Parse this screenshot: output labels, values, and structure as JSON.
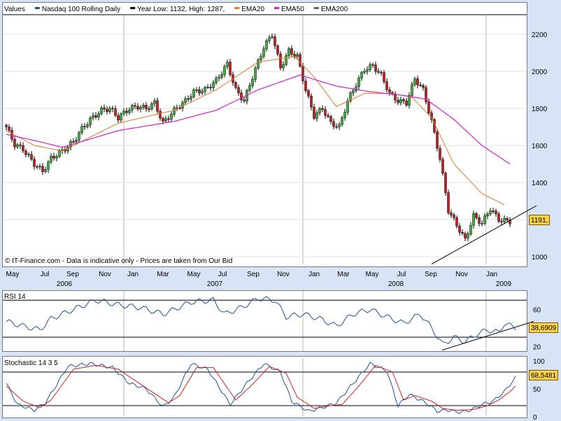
{
  "chart_data": [
    {
      "type": "candlestick",
      "title": "Nasdaq 100 Rolling Daily",
      "legend": [
        {
          "label": "Values",
          "color": "#000000"
        },
        {
          "label": "Nasdaq 100 Rolling Daily",
          "color": "#1f4f9f"
        },
        {
          "label": "Year Low: 1132, High: 1287,",
          "color": "#000000"
        },
        {
          "label": "EMA20",
          "color": "#e07a20"
        },
        {
          "label": "EMA50",
          "color": "#d020d0"
        },
        {
          "label": "EMA200",
          "color": "#606060"
        }
      ],
      "legend_placement": "top-left",
      "footnote": "© IT-Finance.com - Data is indicative only - Prices are taken from Our Bid",
      "ylim": [
        950,
        2300
      ],
      "yticks": [
        1000,
        1200,
        1400,
        1600,
        1800,
        2000,
        2200
      ],
      "ytick_labels": [
        "1000",
        "1190",
        "1400",
        "1600",
        "1800",
        "2000",
        "2200"
      ],
      "month_labels": [
        "May",
        "Jul",
        "Sep",
        "Nov",
        "Jan",
        "Mar",
        "May",
        "Jul",
        "Sep",
        "Nov",
        "Jan",
        "Mar",
        "May",
        "Jul",
        "Sep",
        "Nov",
        "Jan"
      ],
      "year_labels": [
        "2006",
        "2007",
        "2008",
        "2009"
      ],
      "last_value_badge": "1191,",
      "grid": true,
      "close_anchors": [
        [
          0,
          1700
        ],
        [
          3,
          1605
        ],
        [
          6,
          1580
        ],
        [
          10,
          1500
        ],
        [
          13,
          1460
        ],
        [
          16,
          1530
        ],
        [
          20,
          1570
        ],
        [
          24,
          1620
        ],
        [
          27,
          1690
        ],
        [
          30,
          1740
        ],
        [
          34,
          1790
        ],
        [
          37,
          1800
        ],
        [
          40,
          1750
        ],
        [
          44,
          1800
        ],
        [
          47,
          1810
        ],
        [
          50,
          1800
        ],
        [
          53,
          1830
        ],
        [
          56,
          1720
        ],
        [
          60,
          1790
        ],
        [
          64,
          1840
        ],
        [
          67,
          1890
        ],
        [
          71,
          1900
        ],
        [
          75,
          1950
        ],
        [
          79,
          2040
        ],
        [
          82,
          1900
        ],
        [
          85,
          1840
        ],
        [
          88,
          1970
        ],
        [
          92,
          2130
        ],
        [
          95,
          2200
        ],
        [
          98,
          2020
        ],
        [
          101,
          2110
        ],
        [
          104,
          2080
        ],
        [
          107,
          1900
        ],
        [
          110,
          1760
        ],
        [
          113,
          1800
        ],
        [
          116,
          1720
        ],
        [
          119,
          1700
        ],
        [
          122,
          1840
        ],
        [
          125,
          1930
        ],
        [
          128,
          2010
        ],
        [
          131,
          2030
        ],
        [
          134,
          1980
        ],
        [
          137,
          1880
        ],
        [
          140,
          1840
        ],
        [
          143,
          1830
        ],
        [
          146,
          1960
        ],
        [
          149,
          1900
        ],
        [
          152,
          1730
        ],
        [
          155,
          1530
        ],
        [
          158,
          1250
        ],
        [
          161,
          1170
        ],
        [
          164,
          1090
        ],
        [
          167,
          1220
        ],
        [
          170,
          1180
        ],
        [
          173,
          1260
        ],
        [
          176,
          1200
        ],
        [
          180,
          1190
        ]
      ],
      "ema20_anchors": [
        [
          0,
          1680
        ],
        [
          10,
          1600
        ],
        [
          20,
          1570
        ],
        [
          40,
          1720
        ],
        [
          60,
          1790
        ],
        [
          75,
          1900
        ],
        [
          90,
          2050
        ],
        [
          103,
          2080
        ],
        [
          110,
          1970
        ],
        [
          118,
          1810
        ],
        [
          128,
          1880
        ],
        [
          138,
          1880
        ],
        [
          145,
          1860
        ],
        [
          152,
          1750
        ],
        [
          160,
          1500
        ],
        [
          170,
          1340
        ],
        [
          178,
          1280
        ]
      ],
      "ema50_anchors": [
        [
          0,
          1660
        ],
        [
          12,
          1620
        ],
        [
          20,
          1590
        ],
        [
          40,
          1680
        ],
        [
          60,
          1730
        ],
        [
          75,
          1790
        ],
        [
          90,
          1900
        ],
        [
          105,
          1980
        ],
        [
          118,
          1920
        ],
        [
          130,
          1890
        ],
        [
          142,
          1870
        ],
        [
          150,
          1850
        ],
        [
          160,
          1740
        ],
        [
          170,
          1600
        ],
        [
          180,
          1500
        ]
      ],
      "trendline": {
        "from_candle": 152,
        "from_value": 960,
        "to_candle": 182,
        "to_value": 1260
      }
    },
    {
      "type": "line",
      "title": "RSI 14",
      "ylim": [
        15,
        80
      ],
      "yticks": [
        20,
        40,
        60
      ],
      "hlines": [
        30,
        70
      ],
      "last_value_badge": "38,6909",
      "color": "#1f4f9f",
      "anchors": [
        [
          0,
          47
        ],
        [
          6,
          42
        ],
        [
          12,
          38
        ],
        [
          16,
          50
        ],
        [
          24,
          60
        ],
        [
          32,
          70
        ],
        [
          40,
          65
        ],
        [
          48,
          62
        ],
        [
          56,
          55
        ],
        [
          60,
          60
        ],
        [
          66,
          68
        ],
        [
          74,
          70
        ],
        [
          78,
          55
        ],
        [
          84,
          62
        ],
        [
          90,
          72
        ],
        [
          96,
          70
        ],
        [
          100,
          52
        ],
        [
          106,
          55
        ],
        [
          112,
          50
        ],
        [
          118,
          42
        ],
        [
          124,
          55
        ],
        [
          130,
          60
        ],
        [
          136,
          52
        ],
        [
          142,
          45
        ],
        [
          148,
          55
        ],
        [
          152,
          40
        ],
        [
          156,
          22
        ],
        [
          160,
          30
        ],
        [
          164,
          25
        ],
        [
          168,
          33
        ],
        [
          172,
          38
        ],
        [
          176,
          35
        ],
        [
          178,
          45
        ],
        [
          182,
          40
        ]
      ],
      "trendline": {
        "from_candle": 154,
        "from_value": 16,
        "to_candle": 184,
        "to_value": 47
      }
    },
    {
      "type": "line",
      "title": "Stochastic 14 3 5",
      "ylim": [
        0,
        105
      ],
      "yticks": [
        0,
        50,
        100
      ],
      "hlines": [
        20,
        80
      ],
      "last_value_badge": "68,5481",
      "series": [
        {
          "color": "#1f4f9f",
          "anchors": [
            [
              0,
              60
            ],
            [
              4,
              22
            ],
            [
              10,
              12
            ],
            [
              14,
              25
            ],
            [
              22,
              90
            ],
            [
              30,
              95
            ],
            [
              38,
              88
            ],
            [
              44,
              60
            ],
            [
              50,
              50
            ],
            [
              56,
              18
            ],
            [
              60,
              35
            ],
            [
              66,
              95
            ],
            [
              72,
              85
            ],
            [
              80,
              22
            ],
            [
              86,
              60
            ],
            [
              92,
              95
            ],
            [
              98,
              80
            ],
            [
              102,
              28
            ],
            [
              108,
              10
            ],
            [
              114,
              18
            ],
            [
              118,
              25
            ],
            [
              124,
              60
            ],
            [
              130,
              95
            ],
            [
              136,
              82
            ],
            [
              140,
              20
            ],
            [
              144,
              40
            ],
            [
              150,
              25
            ],
            [
              154,
              10
            ],
            [
              158,
              12
            ],
            [
              162,
              8
            ],
            [
              166,
              12
            ],
            [
              170,
              22
            ],
            [
              174,
              28
            ],
            [
              178,
              45
            ],
            [
              182,
              70
            ]
          ]
        },
        {
          "color": "#d02020",
          "anchors": [
            [
              0,
              55
            ],
            [
              6,
              28
            ],
            [
              12,
              16
            ],
            [
              16,
              30
            ],
            [
              24,
              85
            ],
            [
              32,
              92
            ],
            [
              40,
              85
            ],
            [
              46,
              65
            ],
            [
              52,
              45
            ],
            [
              58,
              25
            ],
            [
              62,
              38
            ],
            [
              68,
              88
            ],
            [
              74,
              88
            ],
            [
              82,
              30
            ],
            [
              88,
              58
            ],
            [
              94,
              90
            ],
            [
              100,
              78
            ],
            [
              104,
              35
            ],
            [
              110,
              15
            ],
            [
              116,
              20
            ],
            [
              120,
              22
            ],
            [
              126,
              55
            ],
            [
              132,
              92
            ],
            [
              138,
              80
            ],
            [
              142,
              30
            ],
            [
              146,
              38
            ],
            [
              152,
              28
            ],
            [
              156,
              15
            ],
            [
              160,
              12
            ],
            [
              164,
              12
            ],
            [
              168,
              14
            ],
            [
              172,
              20
            ],
            [
              176,
              30
            ],
            [
              180,
              45
            ],
            [
              182,
              55
            ]
          ]
        }
      ]
    }
  ]
}
